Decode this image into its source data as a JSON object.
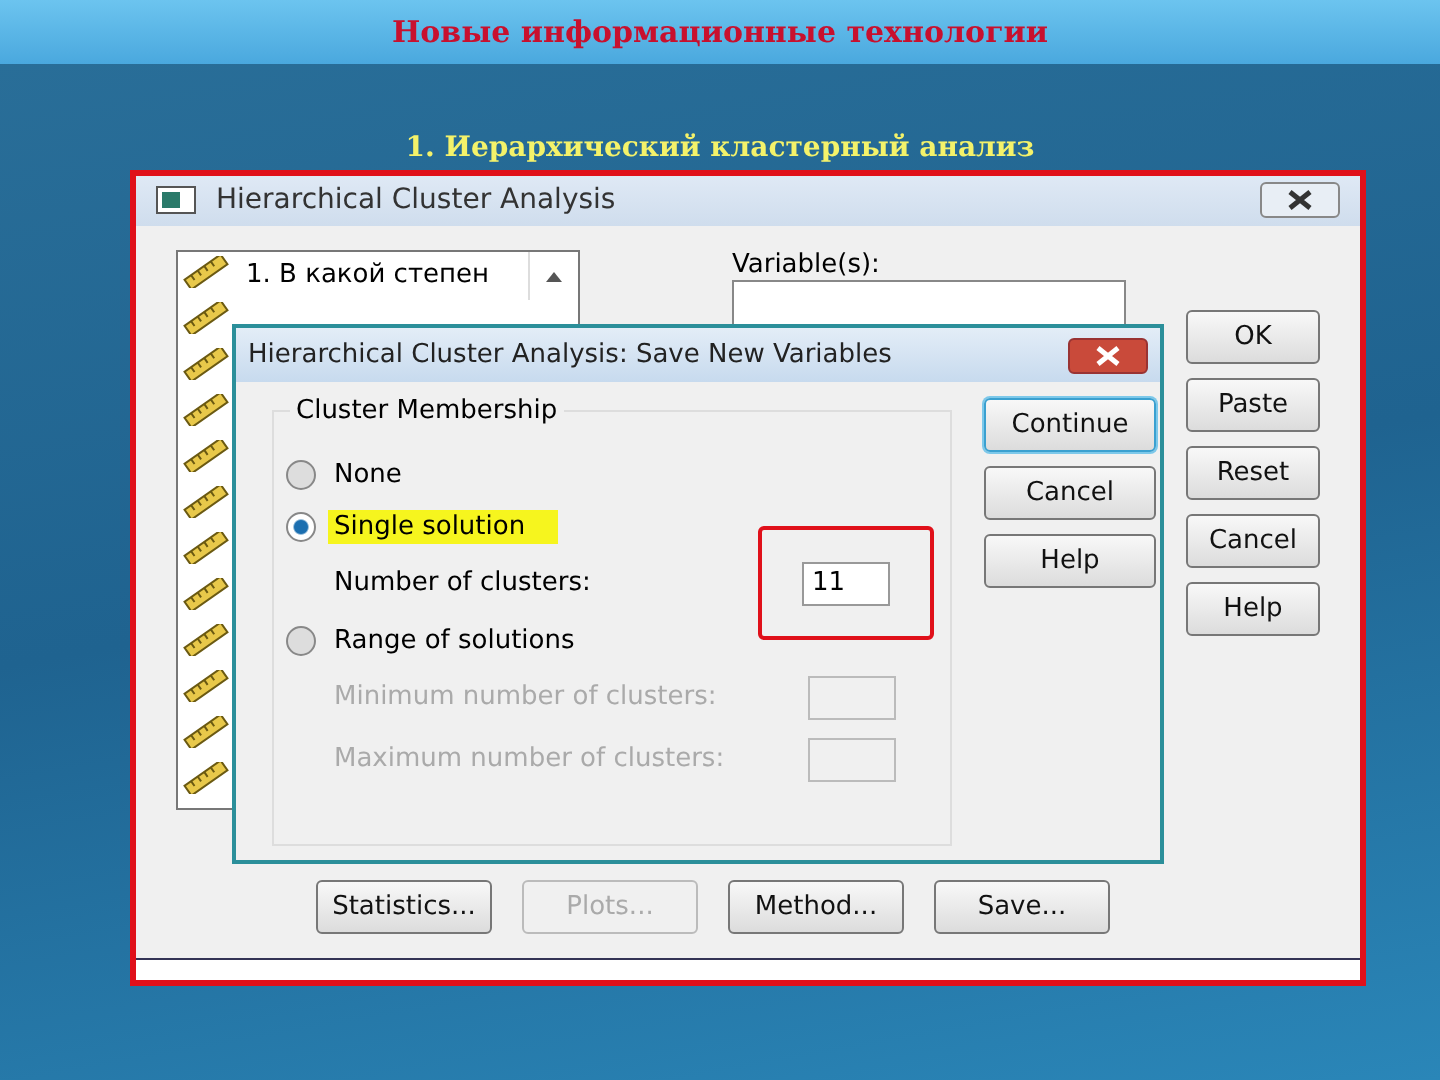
{
  "slide": {
    "title": "Новые информационные технологии",
    "subtitle": "1. Иерархический кластерный анализ"
  },
  "main_window": {
    "title": "Hierarchical Cluster Analysis",
    "source_list": {
      "first_item": "1. В какой степен"
    },
    "variables_label": "Variable(s):",
    "side_buttons": [
      {
        "label": "OK"
      },
      {
        "label": "Paste"
      },
      {
        "label": "Reset"
      },
      {
        "label": "Cancel"
      },
      {
        "label": "Help"
      }
    ],
    "bottom_buttons": [
      {
        "label": "Statistics...",
        "disabled": false
      },
      {
        "label": "Plots...",
        "disabled": true
      },
      {
        "label": "Method...",
        "disabled": false
      },
      {
        "label": "Save...",
        "disabled": false
      }
    ]
  },
  "dialog": {
    "title": "Hierarchical Cluster Analysis: Save New Variables",
    "group_title": "Cluster Membership",
    "options": [
      {
        "label": "None",
        "selected": false,
        "highlighted": false
      },
      {
        "label": "Single solution",
        "selected": true,
        "highlighted": true,
        "fields": [
          {
            "label": "Number of clusters:",
            "value": "11",
            "disabled": false,
            "annotated": true
          }
        ]
      },
      {
        "label": "Range of solutions",
        "selected": false,
        "highlighted": false,
        "fields": [
          {
            "label": "Minimum number of clusters:",
            "disabled": true,
            "annotated": false
          },
          {
            "label": "Maximum number of clusters:",
            "disabled": true,
            "annotated": false
          }
        ]
      }
    ],
    "buttons": [
      {
        "label": "Continue",
        "focused": true
      },
      {
        "label": "Cancel",
        "focused": false
      },
      {
        "label": "Help",
        "focused": false
      }
    ]
  }
}
